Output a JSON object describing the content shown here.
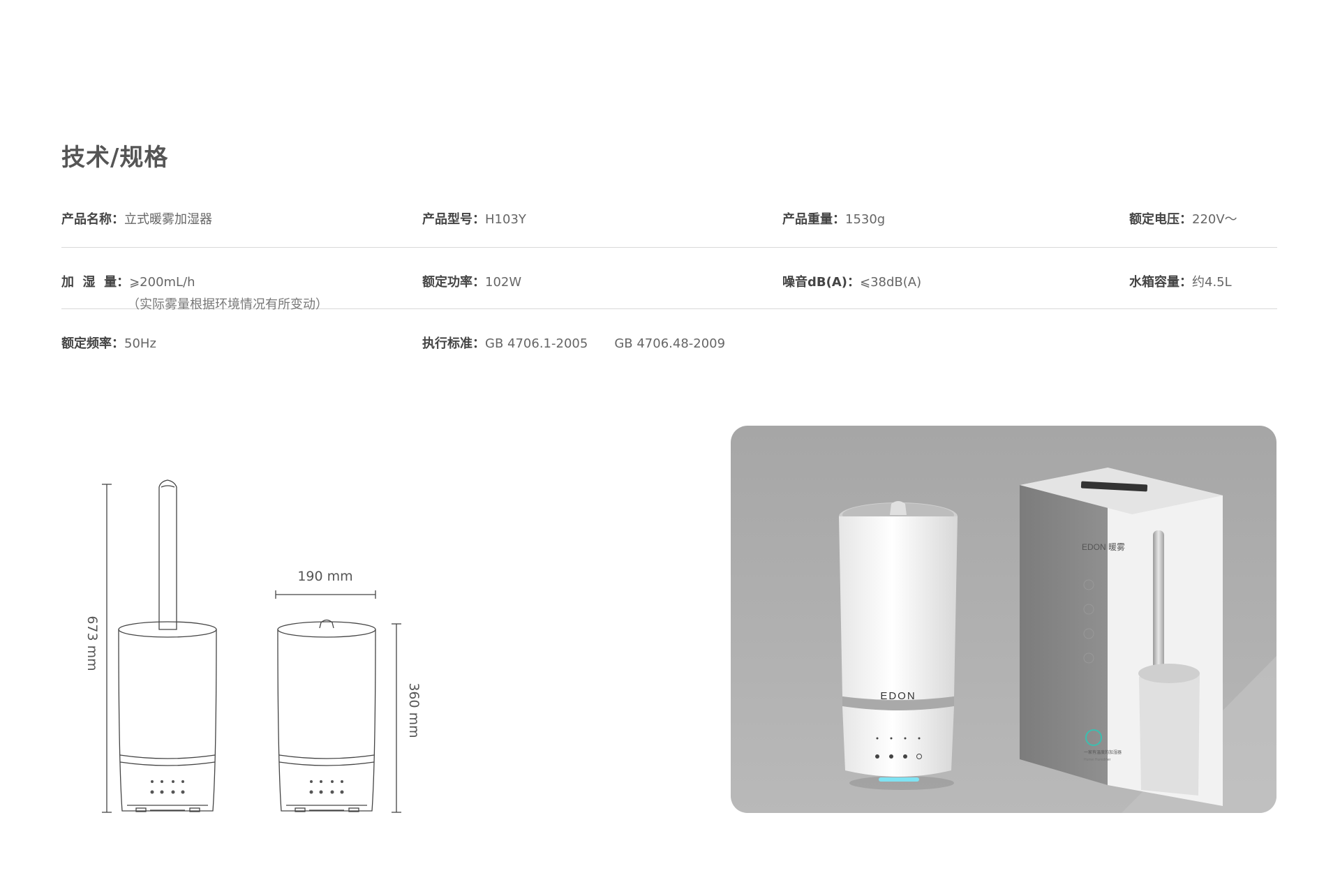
{
  "section_title": "技术/规格",
  "specs": {
    "product_name": {
      "label": "产品名称：",
      "value": "立式暖雾加湿器"
    },
    "model": {
      "label": "产品型号：",
      "value": "H103Y"
    },
    "weight": {
      "label": "产品重量：",
      "value": "1530g"
    },
    "voltage": {
      "label": "额定电压：",
      "value": "220V～"
    },
    "humidify": {
      "label": "加  湿  量：",
      "value": "⩾200mL/h",
      "note": "（实际雾量根据环境情况有所变动）"
    },
    "power": {
      "label": "额定功率：",
      "value": "102W"
    },
    "noise": {
      "label": "噪音dB(A)：",
      "value": "⩽38dB(A)"
    },
    "tank": {
      "label": "水箱容量：",
      "value": "约4.5L"
    },
    "frequency": {
      "label": "额定频率：",
      "value": "50Hz"
    },
    "standard": {
      "label": "执行标准：",
      "value1": "GB 4706.1-2005",
      "value2": "GB 4706.48-2009"
    }
  },
  "dimensions": {
    "total_height": "673 mm",
    "width": "190 mm",
    "body_height": "360 mm"
  },
  "product_photo": {
    "device_brand": "EDON",
    "box_brand": "EDON 暖雾",
    "box_footer": "一家有温度的加湿器",
    "box_footer_en": "Humei Humidifier"
  }
}
